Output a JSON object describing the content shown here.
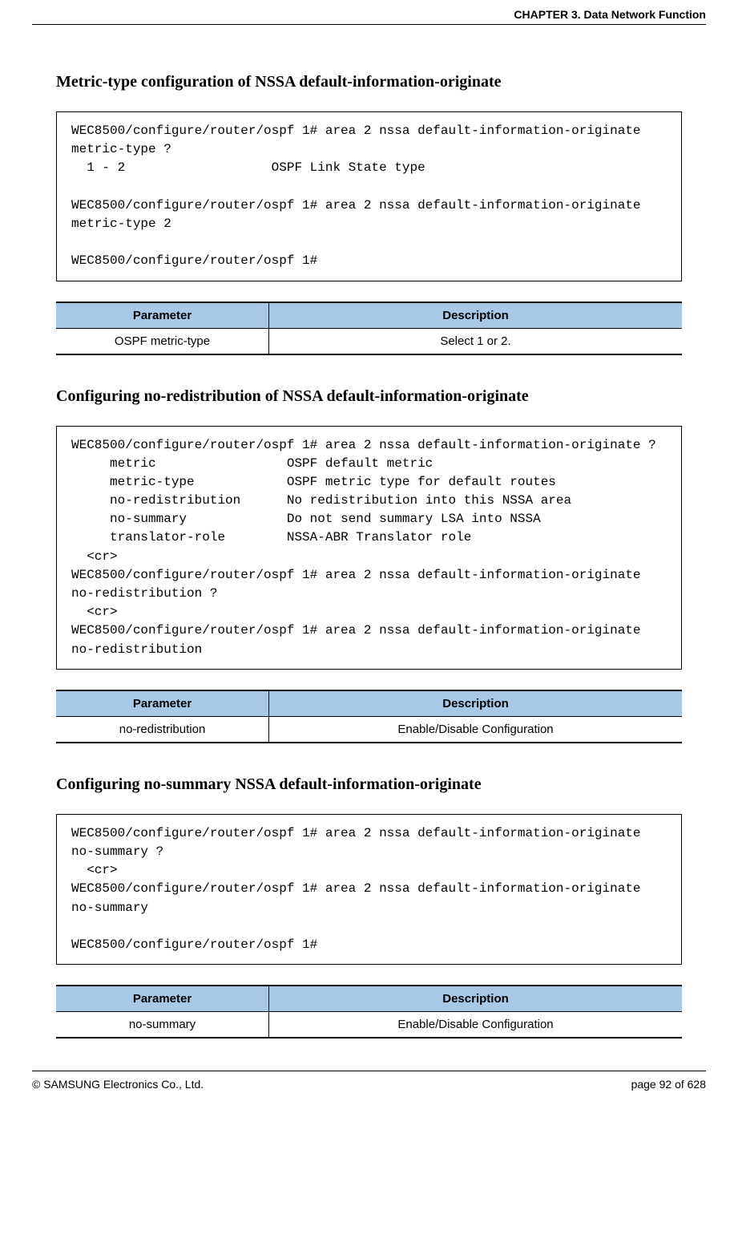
{
  "header": {
    "chapter_title": "CHAPTER 3. Data Network Function"
  },
  "sections": [
    {
      "heading": "Metric-type configuration of NSSA default-information-originate",
      "code": "WEC8500/configure/router/ospf 1# area 2 nssa default-information-originate metric-type ?\n  1 - 2                   OSPF Link State type\n\nWEC8500/configure/router/ospf 1# area 2 nssa default-information-originate metric-type 2\n\nWEC8500/configure/router/ospf 1#",
      "table": {
        "headers": [
          "Parameter",
          "Description"
        ],
        "row": [
          "OSPF metric-type",
          "Select 1 or 2."
        ]
      }
    },
    {
      "heading": "Configuring no-redistribution of NSSA default-information-originate",
      "code": "WEC8500/configure/router/ospf 1# area 2 nssa default-information-originate ?\n     metric                 OSPF default metric\n     metric-type            OSPF metric type for default routes\n     no-redistribution      No redistribution into this NSSA area\n     no-summary             Do not send summary LSA into NSSA\n     translator-role        NSSA-ABR Translator role\n  <cr>\nWEC8500/configure/router/ospf 1# area 2 nssa default-information-originate no-redistribution ?\n  <cr>\nWEC8500/configure/router/ospf 1# area 2 nssa default-information-originate no-redistribution",
      "table": {
        "headers": [
          "Parameter",
          "Description"
        ],
        "row": [
          "no-redistribution",
          "Enable/Disable Configuration"
        ]
      }
    },
    {
      "heading": "Configuring no-summary NSSA default-information-originate",
      "code": "WEC8500/configure/router/ospf 1# area 2 nssa default-information-originate no-summary ?\n  <cr>\nWEC8500/configure/router/ospf 1# area 2 nssa default-information-originate no-summary\n\nWEC8500/configure/router/ospf 1#",
      "table": {
        "headers": [
          "Parameter",
          "Description"
        ],
        "row": [
          "no-summary",
          "Enable/Disable Configuration"
        ]
      }
    }
  ],
  "footer": {
    "copyright": "© SAMSUNG Electronics Co., Ltd.",
    "page_info": "page 92 of 628"
  }
}
